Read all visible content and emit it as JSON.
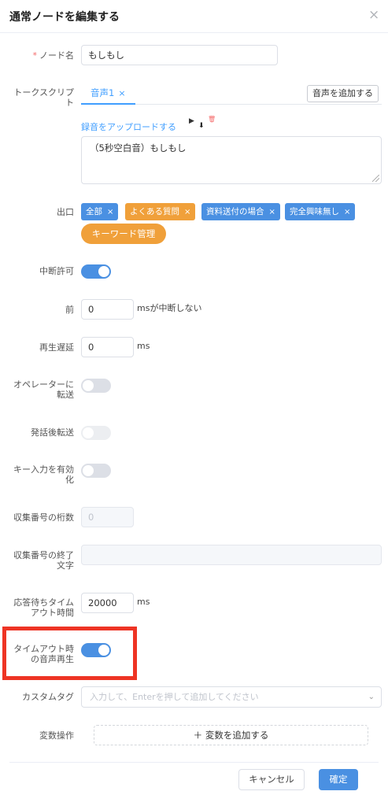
{
  "dialog": {
    "title": "通常ノードを編集する",
    "close_glyph": "×"
  },
  "node_name": {
    "required_mark": "*",
    "label": "ノード名",
    "value": "もしもし"
  },
  "talk_script": {
    "label_l1": "トークスクリプ",
    "label_l2": "ト",
    "tab_label": "音声1",
    "tab_close": "×",
    "add_voice_label": "音声を追加する",
    "upload_label": "録音をアップロードする",
    "play_glyph": "▶",
    "download_glyph": "⬇",
    "delete_glyph": "🗑",
    "text": "（5秒空白音）もしもし"
  },
  "exit": {
    "label": "出口",
    "tags": [
      {
        "label": "全部",
        "color": "#4a90e2"
      },
      {
        "label": "よくある質問",
        "color": "#f0a03a"
      },
      {
        "label": "資料送付の場合",
        "color": "#4a90e2"
      },
      {
        "label": "完全興味無し",
        "color": "#4a90e2"
      }
    ],
    "tag_close": "×",
    "keyword_button": "キーワード管理"
  },
  "interrupt": {
    "label": "中断許可",
    "enabled": true
  },
  "before": {
    "label": "前",
    "value": "0",
    "unit": "msが中断しない"
  },
  "play_delay": {
    "label": "再生遅延",
    "value": "0",
    "unit": "ms"
  },
  "transfer_operator": {
    "label_l1": "オペレーターに",
    "label_l2": "転送",
    "enabled": false
  },
  "after_speech_transfer": {
    "label": "発話後転送",
    "enabled": false,
    "disabled": true
  },
  "key_input": {
    "label_l1": "キー入力を有効",
    "label_l2": "化",
    "enabled": false
  },
  "collect_digits": {
    "label": "収集番号の桁数",
    "value": "0"
  },
  "collect_end": {
    "label_l1": "収集番号の終了",
    "label_l2": "文字",
    "value": ""
  },
  "response_timeout": {
    "label_l1": "応答待ちタイム",
    "label_l2": "アウト時間",
    "value": "20000",
    "unit": "ms"
  },
  "timeout_audio": {
    "label_l1": "タイムアウト時",
    "label_l2": "の音声再生",
    "enabled": true
  },
  "custom_tag": {
    "label": "カスタムタグ",
    "placeholder": "入力して、Enterを押して追加してください",
    "chevron": "⌄"
  },
  "variables": {
    "label": "変数操作",
    "add_label": "＋ 変数を追加する"
  },
  "footer": {
    "cancel_label": "キャンセル",
    "ok_label": "確定"
  },
  "colors": {
    "primary": "#4a90e2",
    "orange": "#f0a03a",
    "highlight": "#ee3424"
  }
}
